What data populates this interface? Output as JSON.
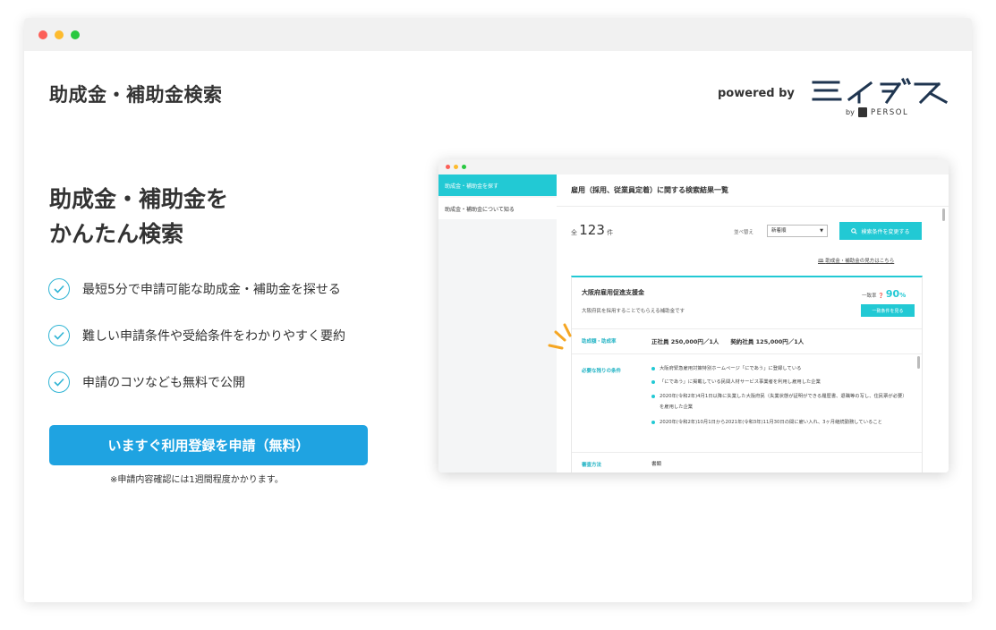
{
  "header": {
    "title": "助成金・補助金検索",
    "powered_by": "powered by",
    "logo_by": "by",
    "logo_persol": "PERSOL"
  },
  "hero": {
    "line1": "助成金・補助金を",
    "line2": "かんたん検索"
  },
  "features": [
    "最短5分で申請可能な助成金・補助金を探せる",
    "難しい申請条件や受給条件をわかりやすく要約",
    "申請のコツなども無料で公開"
  ],
  "cta": {
    "label": "いますぐ利用登録を申請（無料）",
    "note": "※申請内容確認には1週間程度かかります。"
  },
  "preview": {
    "sidebar": [
      "助成金・補助金を探す",
      "助成金・補助金について知る"
    ],
    "heading": "雇用（採用、従業員定着）に関する検索結果一覧",
    "count_prefix": "全",
    "count": "123",
    "count_unit": "件",
    "sort_label": "並べ替え",
    "sort_value": "新着順",
    "change_button": "検索条件を変更する",
    "help_link": "助成金・補助金の見方はこちら",
    "card": {
      "name": "大阪府雇用促進支援金",
      "desc": "大阪府民を採用することでもらえる補助金です",
      "match_label": "一致率",
      "match_value": "90",
      "match_unit": "%",
      "detail_button": "一致条件を見る",
      "amount_label": "助成額・助成率",
      "amount_value": "正社員 250,000円／1人　　契約社員 125,000円／1人",
      "conditions_label": "必要な残りの条件",
      "conditions": [
        "大阪府緊急雇用対策特別ホームページ「にであう」に登録している",
        "「にであう」に掲載している民間人材サービス事業者を利用し雇用した企業",
        "2020年(令和2年)4月1日以降に失業した大阪府民（失業状態が証明ができる履歴書、退職等の写し、住民票が必要）を雇用した企業",
        "2020年(令和2年)10月1日から2021年(令和3年)11月30日の間に雇い入れ、3ヶ月継続勤務していること"
      ],
      "method_label": "審査方法",
      "method_value": "書類"
    }
  },
  "colors": {
    "accent": "#1fa3e1",
    "preview_accent": "#22c9d4",
    "check": "#2fb4d4",
    "sparkle": "#f5a623"
  }
}
